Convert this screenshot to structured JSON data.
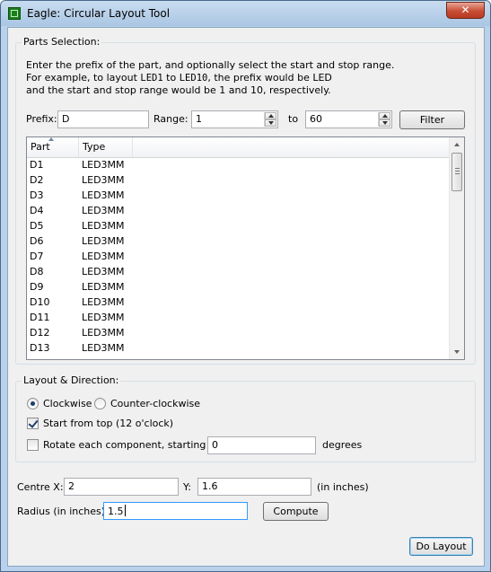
{
  "window": {
    "title": "Eagle: Circular Layout Tool",
    "close_glyph": "✕"
  },
  "parts_selection": {
    "legend": "Parts Selection:",
    "instructions": {
      "line1": "Enter the prefix of the part, and optionally select the start and stop range.",
      "line2_before": "For example, to layout ",
      "line2_code1": "LED1",
      "line2_middle": " to ",
      "line2_code2": "LED10",
      "line2_after": ", the prefix would be LED",
      "line3": "and the start and stop range would be 1 and 10, respectively."
    },
    "prefix_label": "Prefix:",
    "prefix_value": "D",
    "range_label": "Range:",
    "range_start": "1",
    "to_label": "to",
    "range_end": "60",
    "filter_label": "Filter",
    "columns": [
      "Part",
      "Type"
    ],
    "rows": [
      {
        "part": "D1",
        "type": "LED3MM"
      },
      {
        "part": "D2",
        "type": "LED3MM"
      },
      {
        "part": "D3",
        "type": "LED3MM"
      },
      {
        "part": "D4",
        "type": "LED3MM"
      },
      {
        "part": "D5",
        "type": "LED3MM"
      },
      {
        "part": "D6",
        "type": "LED3MM"
      },
      {
        "part": "D7",
        "type": "LED3MM"
      },
      {
        "part": "D8",
        "type": "LED3MM"
      },
      {
        "part": "D9",
        "type": "LED3MM"
      },
      {
        "part": "D10",
        "type": "LED3MM"
      },
      {
        "part": "D11",
        "type": "LED3MM"
      },
      {
        "part": "D12",
        "type": "LED3MM"
      },
      {
        "part": "D13",
        "type": "LED3MM"
      }
    ]
  },
  "layout_direction": {
    "legend": "Layout & Direction:",
    "clockwise_label": "Clockwise",
    "counter_clockwise_label": "Counter-clockwise",
    "start_from_top_label": "Start from top (12 o'clock)",
    "rotate_label": "Rotate each component, starting at",
    "rotate_value": "0",
    "degrees_label": "degrees"
  },
  "centre": {
    "x_label": "Centre X:",
    "x_value": "2",
    "y_label": "Y:",
    "y_value": "1.6",
    "units_label": "(in inches)"
  },
  "radius": {
    "label": "Radius (in inches):",
    "value": "1.5",
    "compute_label": "Compute"
  },
  "do_layout_label": "Do Layout"
}
